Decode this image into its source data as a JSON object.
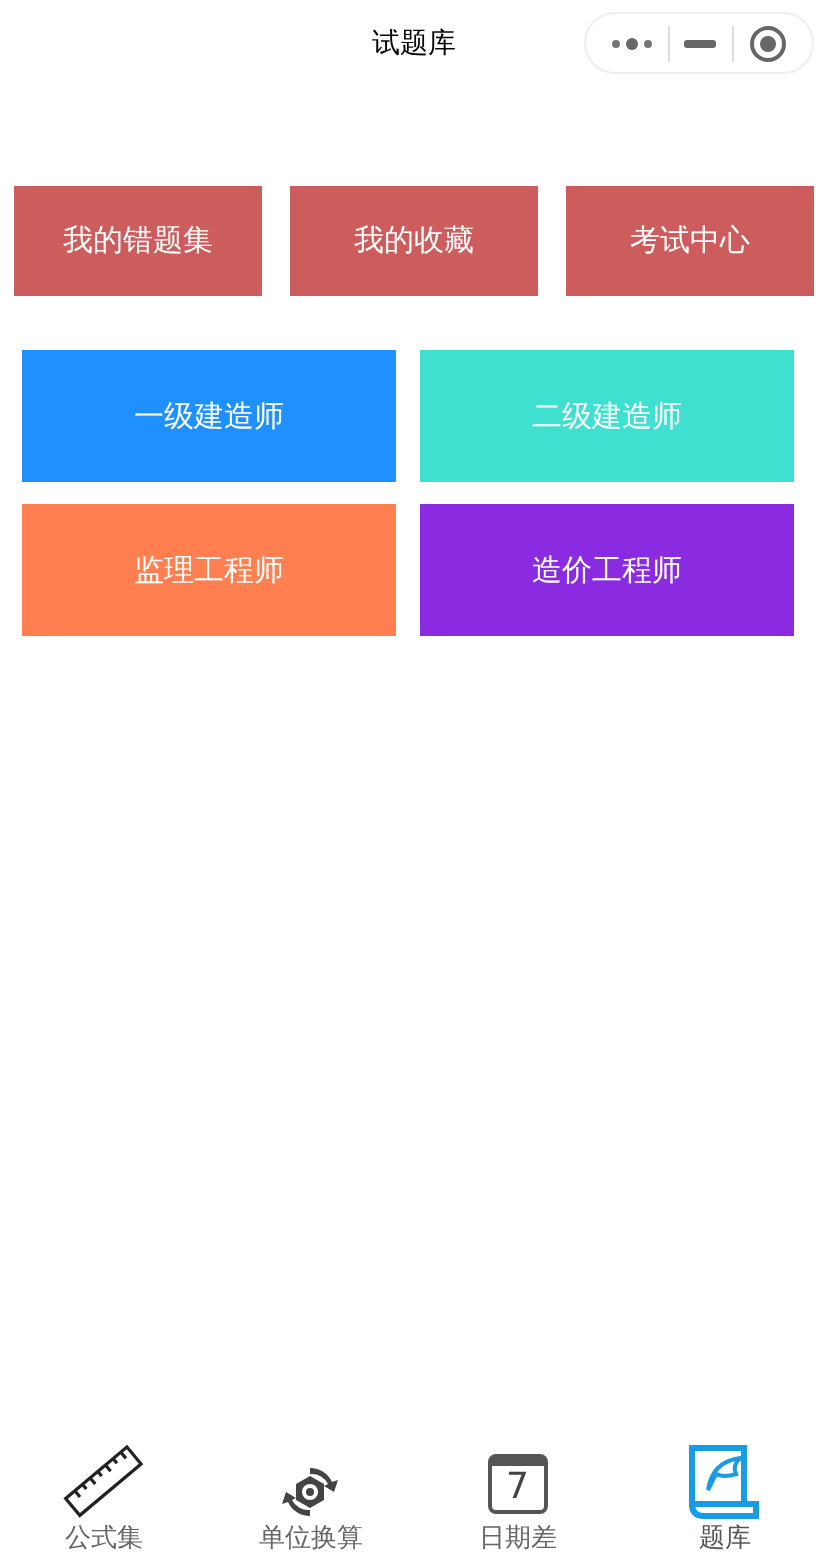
{
  "nav": {
    "title": "试题库"
  },
  "quick_links": [
    {
      "label": "我的错题集"
    },
    {
      "label": "我的收藏"
    },
    {
      "label": "考试中心"
    }
  ],
  "categories": [
    {
      "label": "一级建造师",
      "color": "#1e90ff"
    },
    {
      "label": "二级建造师",
      "color": "#40e0d0"
    },
    {
      "label": "监理工程师",
      "color": "#ff7f50"
    },
    {
      "label": "造价工程师",
      "color": "#8a2be2"
    }
  ],
  "tab_bar": [
    {
      "kind": "ruler",
      "label": "公式集",
      "selected": false
    },
    {
      "kind": "gear",
      "label": "单位换算",
      "selected": false
    },
    {
      "kind": "calendar",
      "label": "日期差",
      "icon_text": "7",
      "selected": false
    },
    {
      "kind": "quill",
      "label": "题库",
      "selected": true
    }
  ]
}
